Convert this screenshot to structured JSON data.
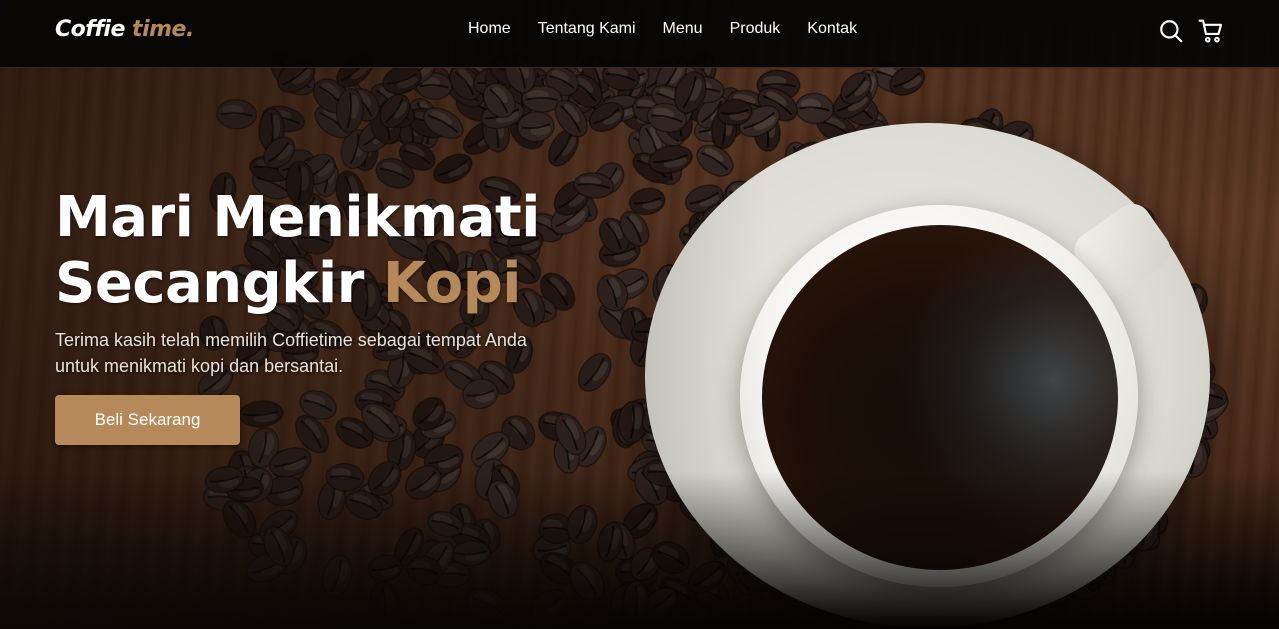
{
  "brand": {
    "name_main": "Coffie",
    "name_accent": "time.",
    "accent_color": "#b6895b"
  },
  "nav": {
    "links": [
      "Home",
      "Tentang Kami",
      "Menu",
      "Produk",
      "Kontak"
    ],
    "icons": [
      "search-icon",
      "shopping-cart-icon"
    ]
  },
  "hero": {
    "headline_line1": "Mari Menikmati",
    "headline_line2": "Secangkir",
    "headline_accent": "Kopi",
    "subtext": "Terima kasih telah memilih Coffietime sebagai tempat Anda untuk menikmati kopi dan bersantai.",
    "cta_label": "Beli Sekarang"
  }
}
